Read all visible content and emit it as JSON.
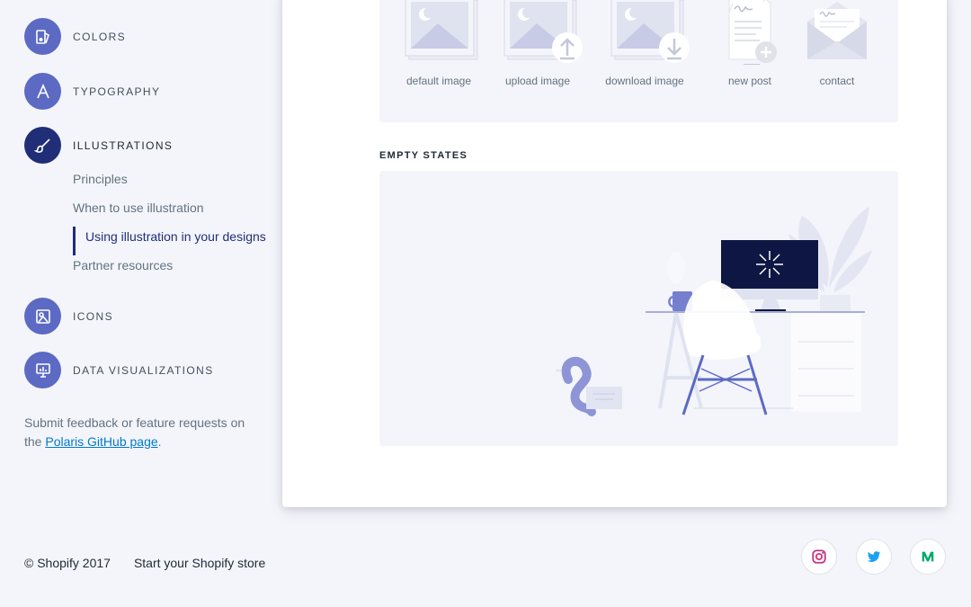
{
  "sidebar": {
    "sections": [
      {
        "label": "COLORS",
        "icon": "colors-icon"
      },
      {
        "label": "TYPOGRAPHY",
        "icon": "typography-icon"
      },
      {
        "label": "ILLUSTRATIONS",
        "icon": "brush-icon",
        "active": true
      },
      {
        "label": "ICONS",
        "icon": "icons-icon"
      },
      {
        "label": "DATA VISUALIZATIONS",
        "icon": "data-visualization-icon"
      }
    ],
    "illustrations_sub": [
      {
        "label": "Principles"
      },
      {
        "label": "When to use illustration"
      },
      {
        "label": "Using illustration in your designs",
        "active": true
      },
      {
        "label": "Partner resources"
      }
    ],
    "feedback": {
      "text_before": "Submit feedback or feature requests on the ",
      "link": "Polaris GitHub page",
      "text_after": "."
    }
  },
  "main": {
    "illustrations_row": [
      {
        "caption": "default image"
      },
      {
        "caption": "upload image"
      },
      {
        "caption": "download image"
      },
      {
        "caption": "new post"
      },
      {
        "caption": "contact"
      }
    ],
    "empty_states_heading": "EMPTY STATES"
  },
  "footer": {
    "copyright": "© Shopify 2017",
    "store_link": "Start your Shopify store",
    "social": [
      {
        "icon": "instagram-icon"
      },
      {
        "icon": "twitter-icon"
      },
      {
        "icon": "medium-icon"
      }
    ]
  },
  "colors": {
    "indigo": "#5c6ac4",
    "indigo_dark": "#202e78",
    "panel_bg": "#f4f5fa",
    "link_blue": "#007ace",
    "twitter_blue": "#1da1f2",
    "medium_green": "#00ab6c"
  }
}
